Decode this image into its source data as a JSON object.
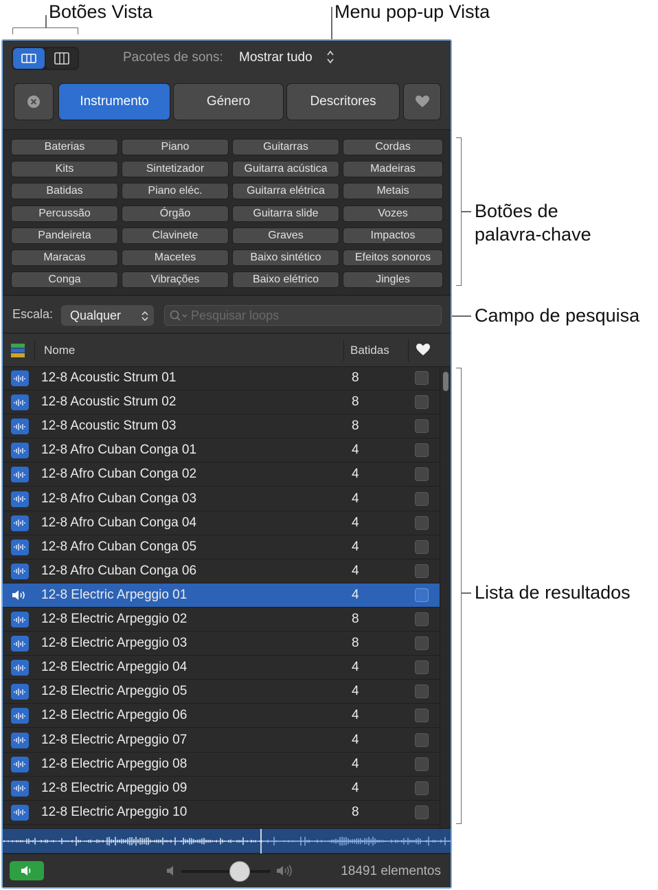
{
  "annotations": {
    "view_buttons": "Botões Vista",
    "view_popup": "Menu pop-up Vista",
    "keyword_buttons_line1": "Botões de",
    "keyword_buttons_line2": "palavra-chave",
    "search_field": "Campo de pesquisa",
    "results_list": "Lista de resultados"
  },
  "header": {
    "pack_label": "Pacotes de sons:",
    "pack_value": "Mostrar tudo",
    "tabs": [
      "Instrumento",
      "Género",
      "Descritores"
    ],
    "active_tab": "Instrumento"
  },
  "keywords": [
    [
      "Baterias",
      "Piano",
      "Guitarras",
      "Cordas"
    ],
    [
      "Kits",
      "Sintetizador",
      "Guitarra acústica",
      "Madeiras"
    ],
    [
      "Batidas",
      "Piano eléc.",
      "Guitarra elétrica",
      "Metais"
    ],
    [
      "Percussão",
      "Órgão",
      "Guitarra slide",
      "Vozes"
    ],
    [
      "Pandeireta",
      "Clavinete",
      "Graves",
      "Impactos"
    ],
    [
      "Maracas",
      "Macetes",
      "Baixo sintético",
      "Efeitos sonoros"
    ],
    [
      "Conga",
      "Vibrações",
      "Baixo elétrico",
      "Jingles"
    ]
  ],
  "search": {
    "scale_label": "Escala:",
    "scale_value": "Qualquer",
    "placeholder": "Pesquisar loops"
  },
  "columns": {
    "name": "Nome",
    "beats": "Batidas"
  },
  "results": [
    {
      "name": "12-8 Acoustic Strum 01",
      "beats": "8"
    },
    {
      "name": "12-8 Acoustic Strum 02",
      "beats": "8"
    },
    {
      "name": "12-8 Acoustic Strum 03",
      "beats": "8"
    },
    {
      "name": "12-8 Afro Cuban Conga 01",
      "beats": "4"
    },
    {
      "name": "12-8 Afro Cuban Conga 02",
      "beats": "4"
    },
    {
      "name": "12-8 Afro Cuban Conga 03",
      "beats": "4"
    },
    {
      "name": "12-8 Afro Cuban Conga 04",
      "beats": "4"
    },
    {
      "name": "12-8 Afro Cuban Conga 05",
      "beats": "4"
    },
    {
      "name": "12-8 Afro Cuban Conga 06",
      "beats": "4"
    },
    {
      "name": "12-8 Electric Arpeggio 01",
      "beats": "4",
      "selected": true
    },
    {
      "name": "12-8 Electric Arpeggio 02",
      "beats": "8"
    },
    {
      "name": "12-8 Electric Arpeggio 03",
      "beats": "8"
    },
    {
      "name": "12-8 Electric Arpeggio 04",
      "beats": "4"
    },
    {
      "name": "12-8 Electric Arpeggio 05",
      "beats": "4"
    },
    {
      "name": "12-8 Electric Arpeggio 06",
      "beats": "4"
    },
    {
      "name": "12-8 Electric Arpeggio 07",
      "beats": "4"
    },
    {
      "name": "12-8 Electric Arpeggio 08",
      "beats": "4"
    },
    {
      "name": "12-8 Electric Arpeggio 09",
      "beats": "4"
    },
    {
      "name": "12-8 Electric Arpeggio 10",
      "beats": "8"
    }
  ],
  "footer": {
    "count": "18491 elementos",
    "volume": 0.65
  },
  "icons": {
    "view_a": "list-view-icon",
    "view_b": "column-view-icon",
    "clear": "clear-icon",
    "favorites": "heart-icon",
    "search": "search-icon",
    "loop": "waveform-icon",
    "playing": "speaker-icon"
  },
  "colors": {
    "accent": "#2e6fd0",
    "selected_row": "#2d63b6",
    "preview_green": "#2ea043",
    "panel_border": "#79aee6"
  }
}
